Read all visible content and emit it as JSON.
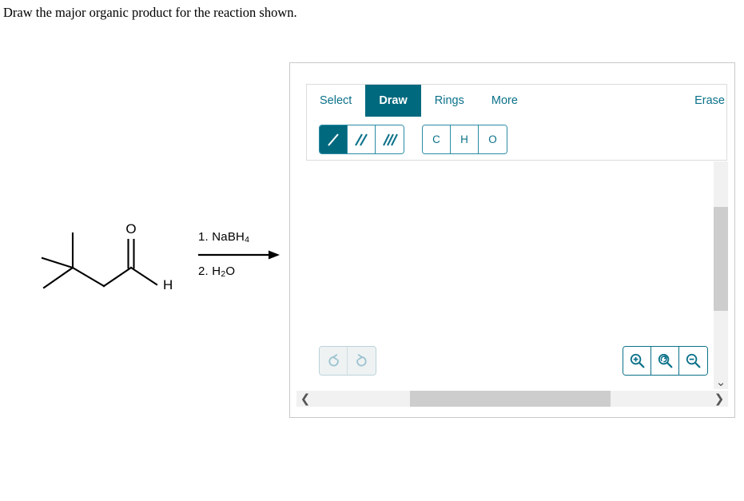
{
  "question": {
    "prompt": "Draw the major organic product for the reaction shown."
  },
  "reaction": {
    "reactant_name": "3,3-dimethylbutanal",
    "reactant_labels": {
      "carbonyl_oxygen": "O",
      "aldehyde_hydrogen": "H"
    },
    "reagent_above": "1. NaBH",
    "reagent_above_sub": "4",
    "reagent_below": "2. H",
    "reagent_below_sub": "2",
    "reagent_below_tail": "O",
    "arrow": "reaction-arrow"
  },
  "editor": {
    "tabs": [
      {
        "label": "Select",
        "active": false
      },
      {
        "label": "Draw",
        "active": true
      },
      {
        "label": "Rings",
        "active": false
      },
      {
        "label": "More",
        "active": false
      }
    ],
    "erase_label": "Erase",
    "bond_tools": [
      {
        "name": "single-bond",
        "active": true
      },
      {
        "name": "double-bond",
        "active": false
      },
      {
        "name": "triple-bond",
        "active": false
      }
    ],
    "atom_tools": [
      {
        "label": "C"
      },
      {
        "label": "H"
      },
      {
        "label": "O"
      }
    ],
    "actions": [
      {
        "name": "undo-icon"
      },
      {
        "name": "redo-icon"
      }
    ],
    "zoom_controls": [
      {
        "name": "zoom-in-icon"
      },
      {
        "name": "zoom-reset-icon"
      },
      {
        "name": "zoom-out-icon"
      }
    ],
    "colors": {
      "accent": "#00697e",
      "link": "#0b7189",
      "border": "#2a8ba3",
      "panel_border": "#dcdcdc",
      "frame_border": "#c9c9c9",
      "scroll_track": "#f1f1f1",
      "scroll_thumb": "#cdcdcd"
    },
    "scrollbars": {
      "vertical_arrow": "chevron-down",
      "horizontal_left_arrow": "chevron-left",
      "horizontal_right_arrow": "chevron-right"
    }
  }
}
